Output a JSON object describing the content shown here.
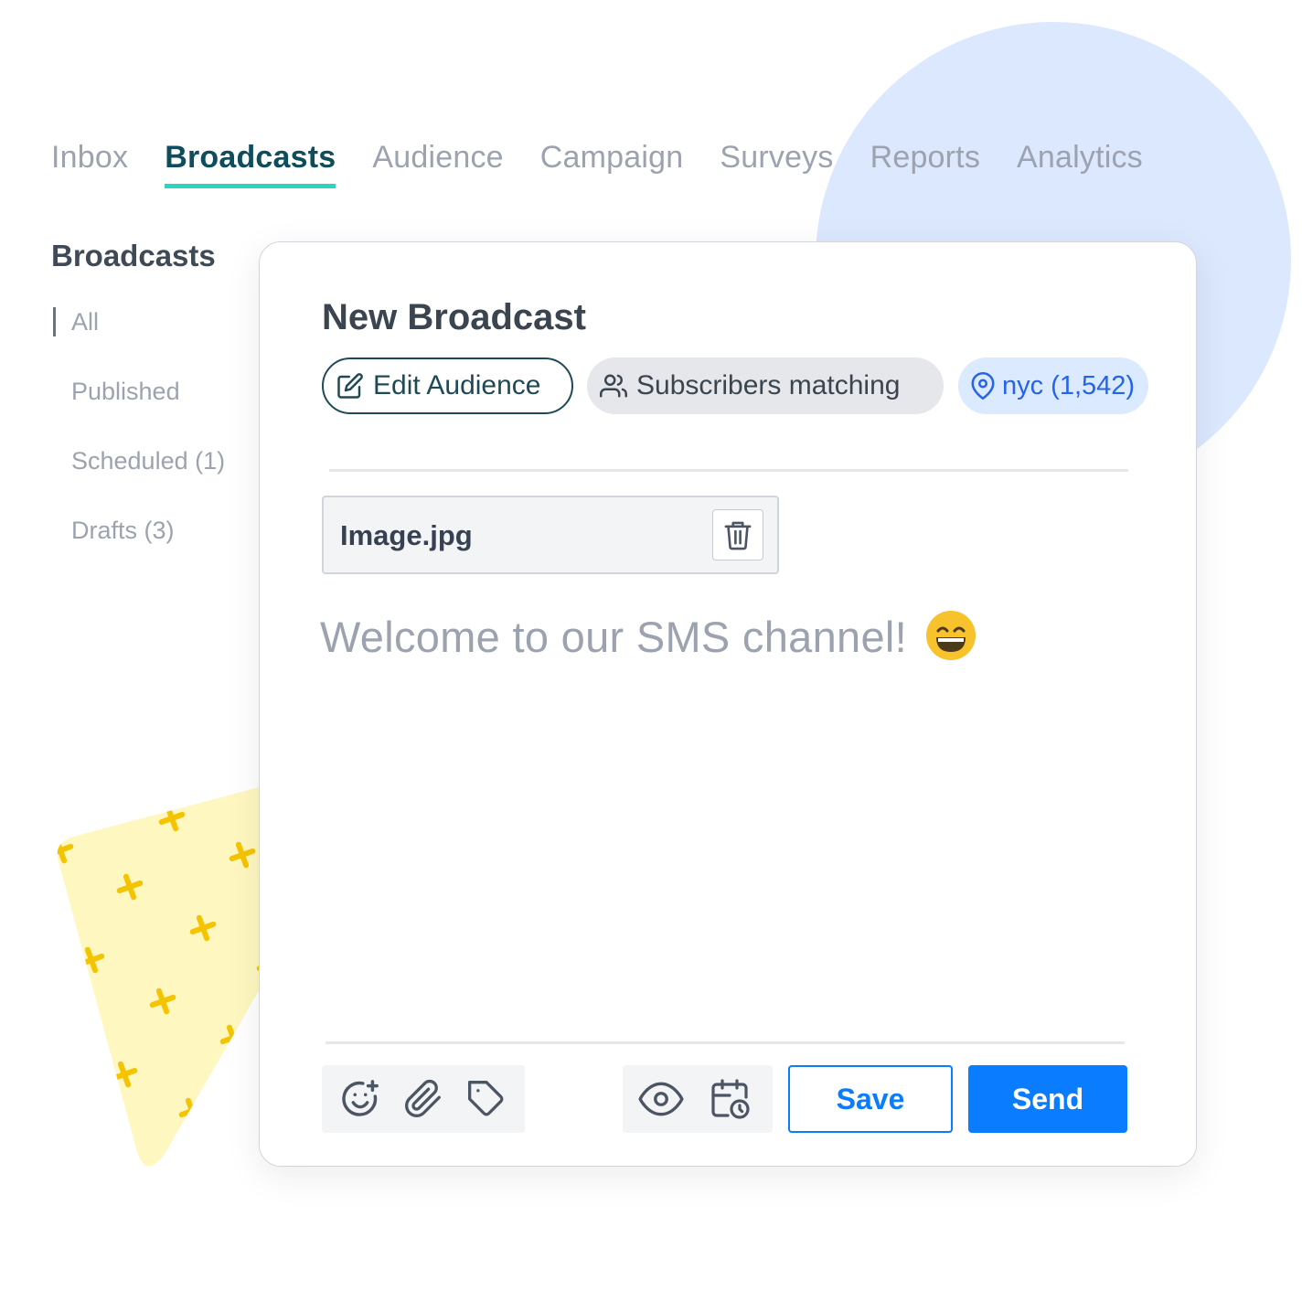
{
  "nav": {
    "tabs": [
      {
        "label": "Inbox"
      },
      {
        "label": "Broadcasts",
        "active": true
      },
      {
        "label": "Audience"
      },
      {
        "label": "Campaign"
      },
      {
        "label": "Surveys"
      },
      {
        "label": "Reports"
      },
      {
        "label": "Analytics"
      }
    ]
  },
  "sidebar": {
    "title": "Broadcasts",
    "items": [
      {
        "label": "All",
        "active": true
      },
      {
        "label": "Published"
      },
      {
        "label": "Scheduled (1)"
      },
      {
        "label": "Drafts (3)"
      }
    ]
  },
  "broadcast": {
    "title": "New Broadcast",
    "edit_audience_label": "Edit Audience",
    "subscribers_label": "Subscribers matching",
    "segment_label": "nyc (1,542)",
    "attachment_name": "Image.jpg",
    "message_text": "Welcome to our SMS channel!",
    "message_emoji": "grinning-face-emoji"
  },
  "toolbar": {
    "icons": [
      "add-emoji-icon",
      "paperclip-icon",
      "tag-icon",
      "eye-icon",
      "calendar-clock-icon"
    ],
    "save_label": "Save",
    "send_label": "Send"
  },
  "colors": {
    "accent": "#0a7cff",
    "active_tab": "#0f4c5c",
    "tab_underline": "#2dd4bf",
    "segment_chip_bg": "#dbeafe",
    "decor_circle": "#dbe8fd",
    "decor_triangle": "#fef7c0"
  }
}
